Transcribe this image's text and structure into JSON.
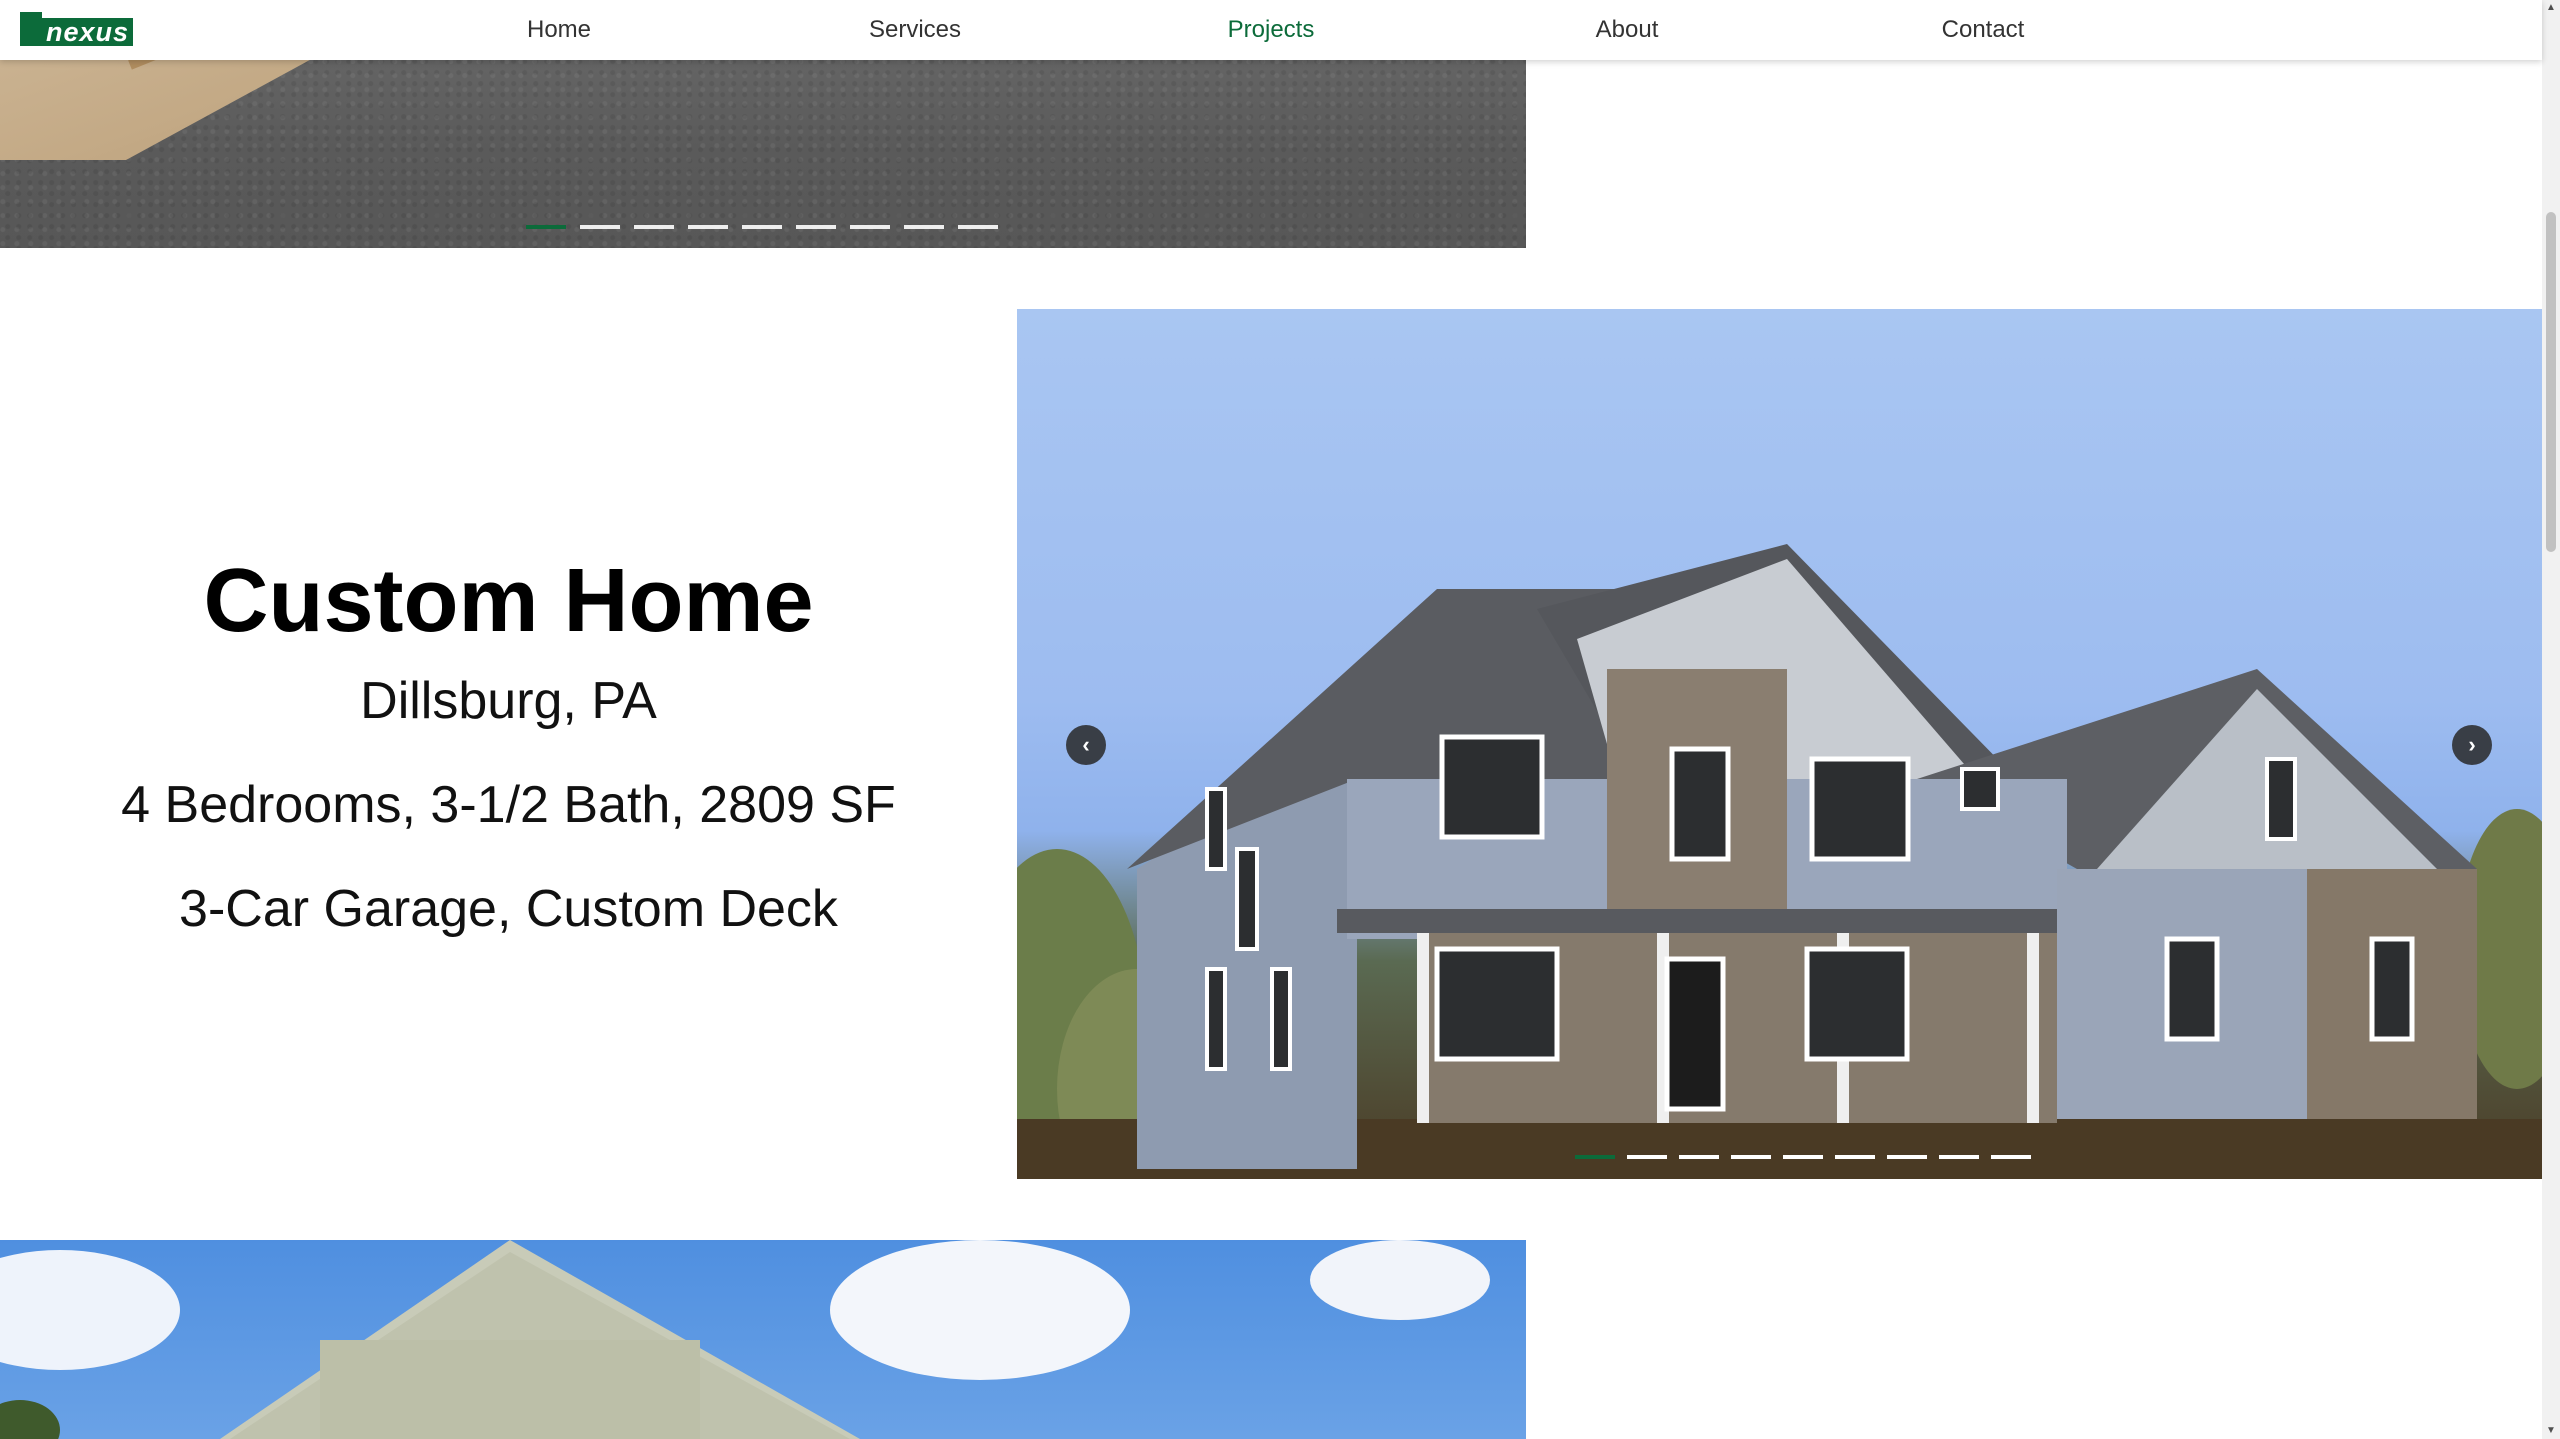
{
  "header": {
    "logo_text": "nexus",
    "nav": [
      {
        "label": "Home",
        "active": false
      },
      {
        "label": "Services",
        "active": false
      },
      {
        "label": "Projects",
        "active": true
      },
      {
        "label": "About",
        "active": false
      },
      {
        "label": "Contact",
        "active": false
      }
    ]
  },
  "top_slider": {
    "slide_count": 9,
    "active_index": 0
  },
  "project": {
    "title": "Custom Home",
    "location": "Dillsburg, PA",
    "specs": "4 Bedrooms, 3-1/2 Bath, 2809 SF",
    "features": "3-Car Garage, Custom Deck"
  },
  "main_slider": {
    "prev_icon": "chevron-left-icon",
    "next_icon": "chevron-right-icon",
    "slide_count": 9,
    "active_index": 0
  },
  "colors": {
    "brand": "#0c6b3a",
    "nav_text": "#333333",
    "nav_active": "#0c6b3a"
  }
}
